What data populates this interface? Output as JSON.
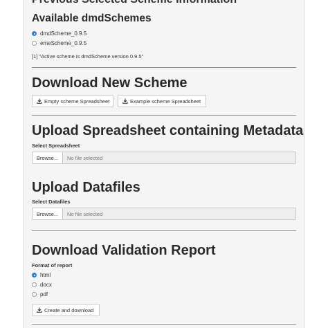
{
  "top_cut_title": "Previous Selected Scheme Information",
  "schemes": {
    "heading": "Available dmdSchemes",
    "options": [
      {
        "label": "dmdScheme_0.9.5",
        "checked": true
      },
      {
        "label": "emeScheme_0.9.5",
        "checked": false
      }
    ],
    "console_output": "[1] \"Active scheme is dmdScheme version 0.9.5\""
  },
  "download_new": {
    "heading": "Download New Scheme",
    "empty_button": "Empty scheme Spreadsheet",
    "example_button": "Example scheme Spreadsheet"
  },
  "upload_spreadsheet": {
    "heading": "Upload Spreadsheet containing Metadata",
    "label": "Select Spreadsheet",
    "browse_button": "Browse...",
    "file_status": "No file selected"
  },
  "upload_datafiles": {
    "heading": "Upload Datafiles",
    "label": "Select Datafiles",
    "browse_button": "Browse...",
    "file_status": "No file selected"
  },
  "validation": {
    "heading": "Download Validation Report",
    "format_label": "Format of report",
    "formats": [
      {
        "label": "html",
        "checked": true
      },
      {
        "label": "docx",
        "checked": false
      },
      {
        "label": "pdf",
        "checked": false
      }
    ],
    "create_button": "Create and download"
  },
  "colors": {
    "accent": "#2f7fd6",
    "panel_background": "#f5f5f5",
    "rule": "#8a8a8a"
  },
  "icons": {
    "download": "download-icon"
  }
}
